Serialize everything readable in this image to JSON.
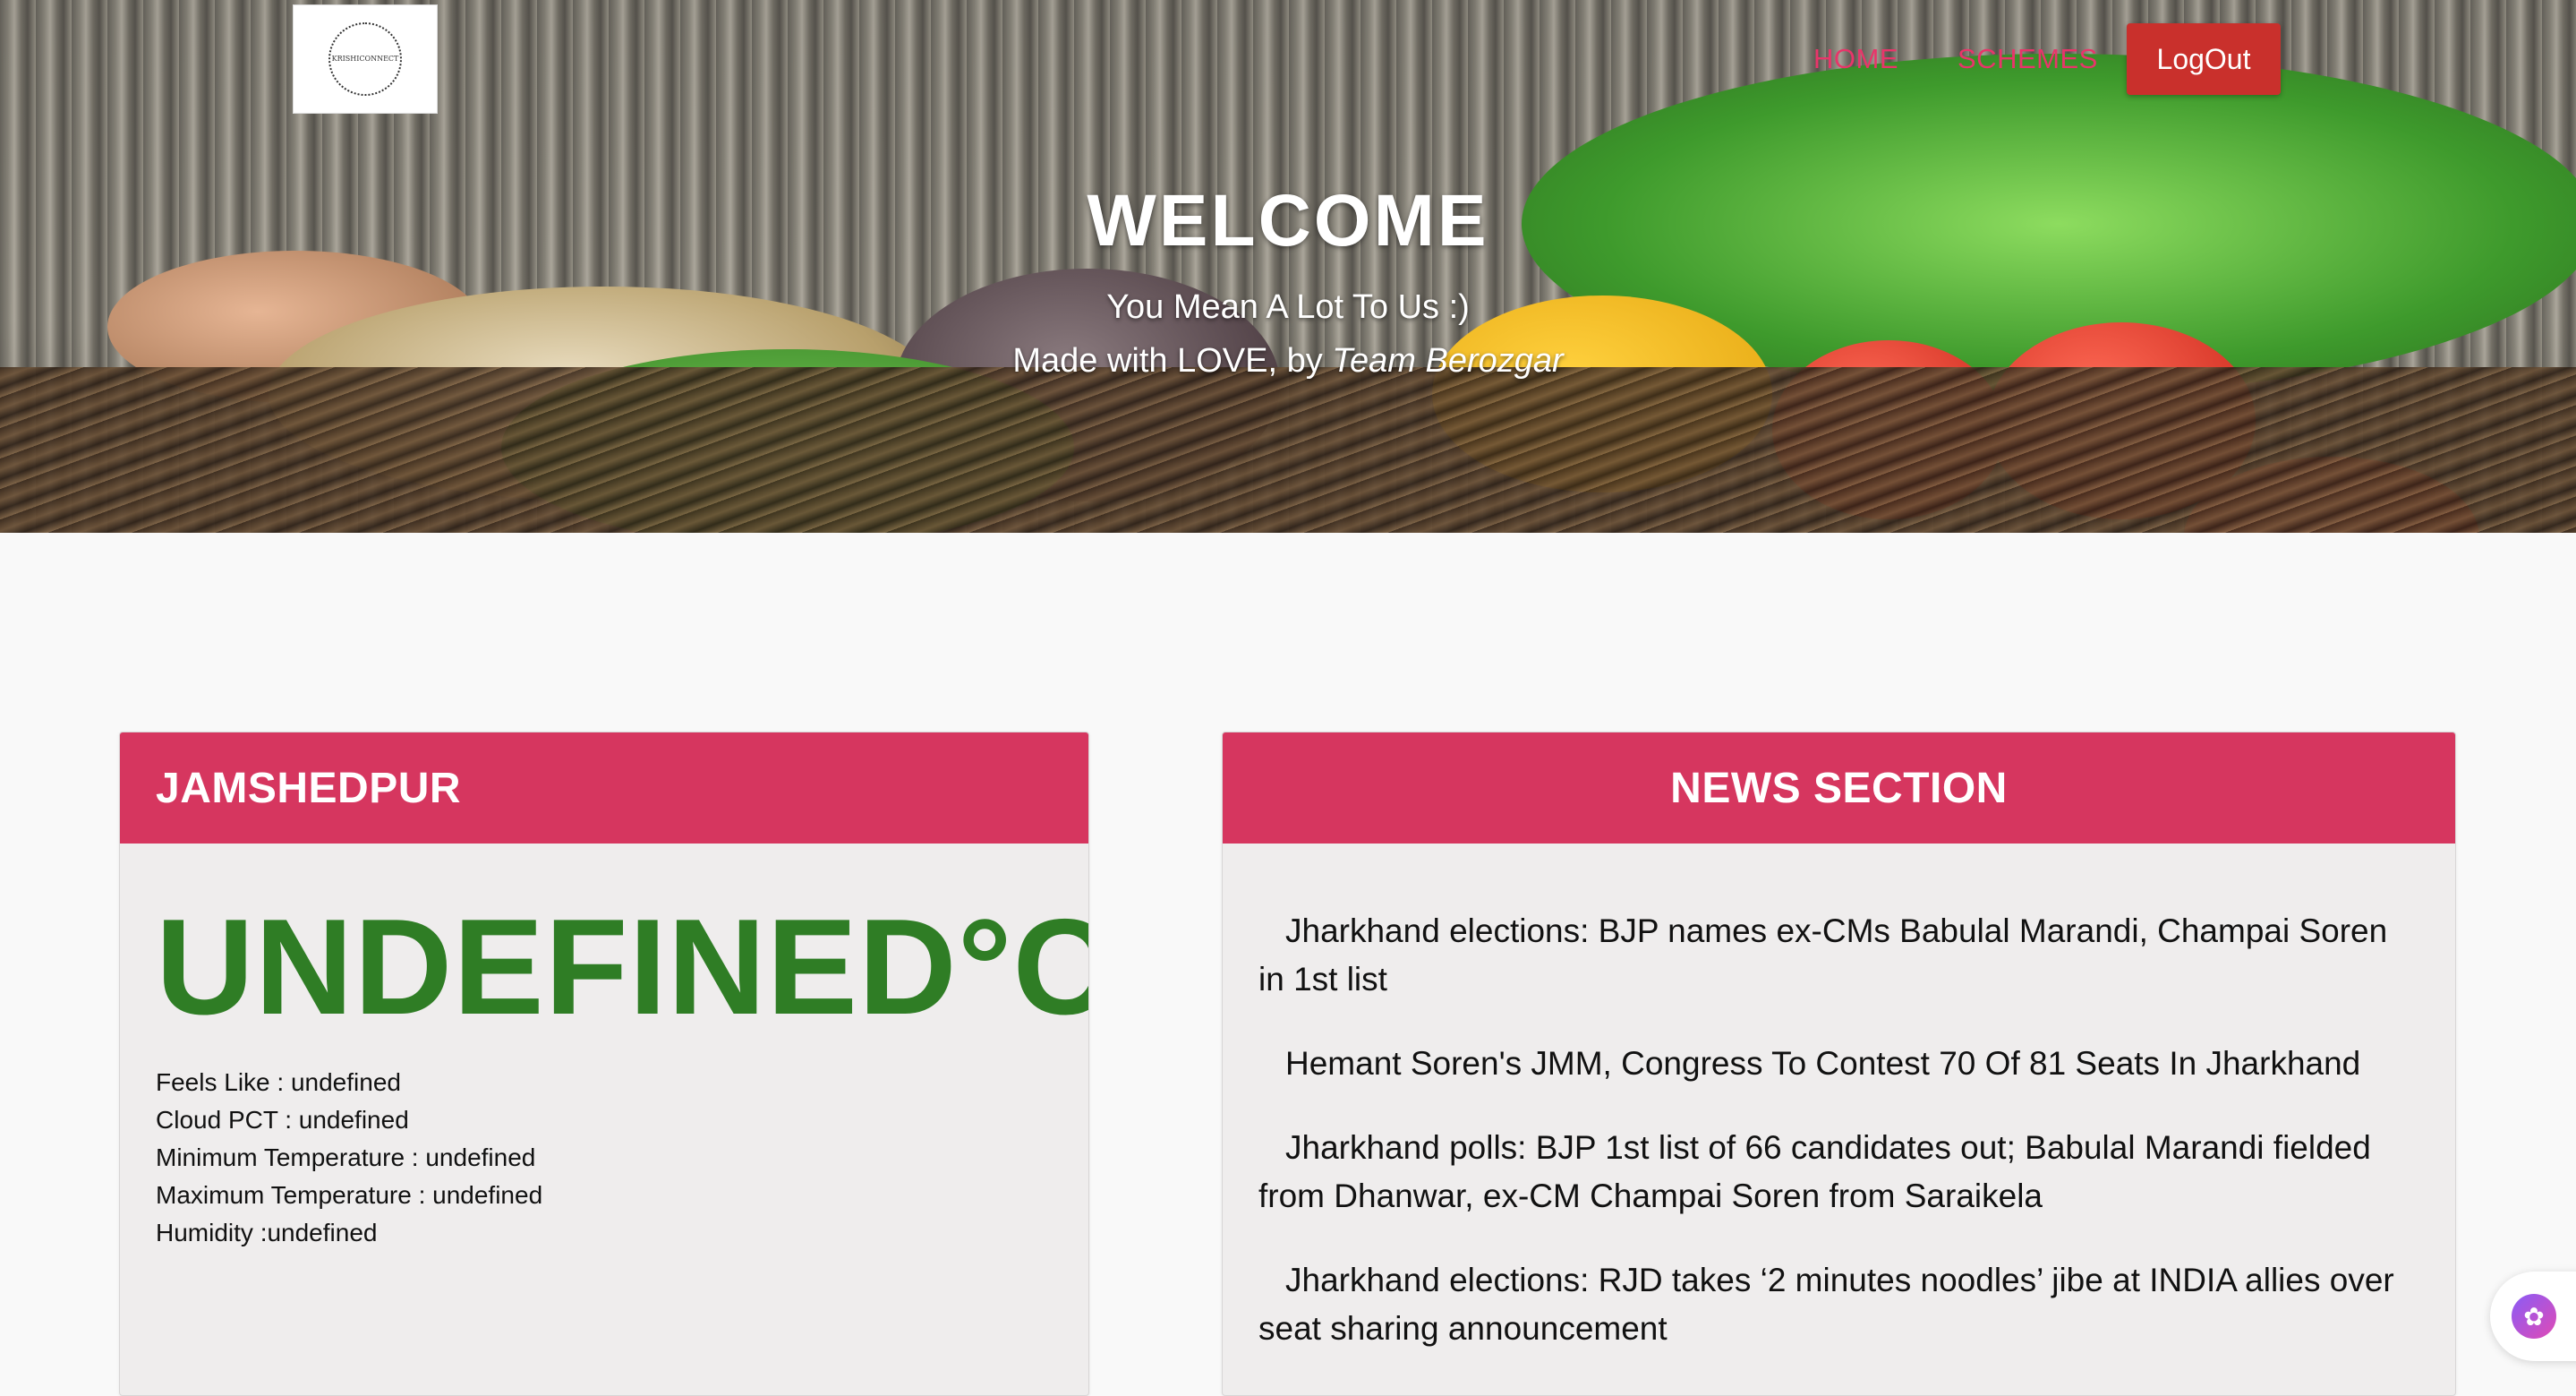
{
  "header": {
    "logo_text": "KRISHICONNECT",
    "nav": {
      "home": "HOME",
      "schemes": "SCHEMES",
      "logout": "LogOut"
    }
  },
  "hero": {
    "title": "WELCOME",
    "subtitle_line1": "You Mean A Lot To Us :)",
    "subtitle_line2_prefix": "Made with LOVE, by ",
    "subtitle_line2_team": "Team Berozgar"
  },
  "weather": {
    "city": "JAMSHEDPUR",
    "temperature": "UNDEFINED°C",
    "details": [
      "Feels Like : undefined",
      "Cloud PCT : undefined",
      "Minimum Temperature : undefined",
      "Maximum Temperature : undefined",
      "Humidity :undefined"
    ]
  },
  "news": {
    "title": "NEWS SECTION",
    "items": [
      "Jharkhand elections: BJP names ex-CMs Babulal Marandi, Champai Soren in 1st list",
      "Hemant Soren's JMM, Congress To Contest 70 Of 81 Seats In Jharkhand",
      "Jharkhand polls: BJP 1st list of 66 candidates out; Babulal Marandi fielded from Dhanwar, ex-CM Champai Soren from Saraikela",
      "Jharkhand elections: RJD takes ‘2 minutes noodles’ jibe at INDIA allies over seat sharing announcement"
    ]
  },
  "colors": {
    "accent_pink": "#d6365f",
    "nav_link": "#e8356a",
    "logout_red": "#c9302c",
    "temp_green": "#2f7d25"
  },
  "icons": {
    "assistant": "brain-icon"
  }
}
